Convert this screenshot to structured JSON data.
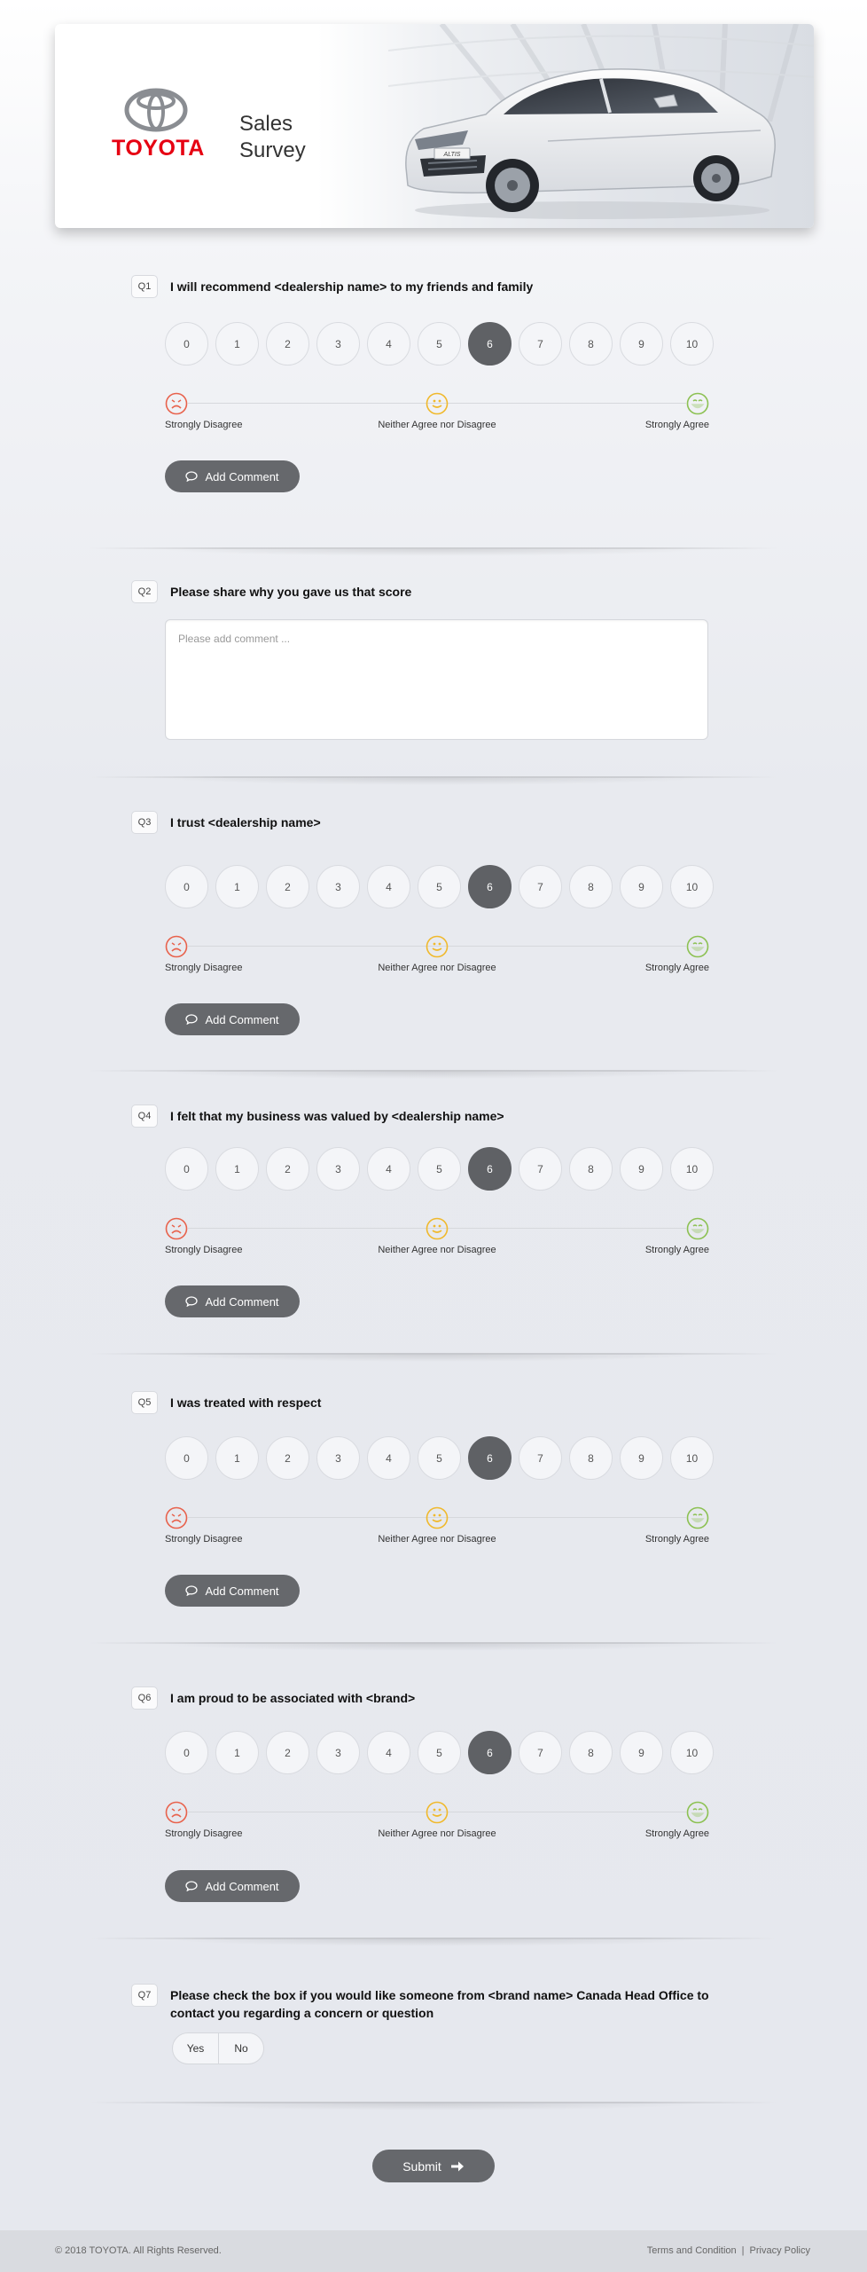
{
  "header": {
    "brand": "TOYOTA",
    "title_line1": "Sales",
    "title_line2": "Survey",
    "car_badge": "ALTIS"
  },
  "scale": {
    "options": [
      "0",
      "1",
      "2",
      "3",
      "4",
      "5",
      "6",
      "7",
      "8",
      "9",
      "10"
    ],
    "left_label": "Strongly Disagree",
    "mid_label": "Neither Agree nor Disagree",
    "right_label": "Strongly Agree"
  },
  "add_comment_label": "Add Comment",
  "questions": {
    "q1": {
      "num": "Q1",
      "text": "I will recommend <dealership name> to my friends and family",
      "selected": 6
    },
    "q2": {
      "num": "Q2",
      "text": "Please share why you gave us that score",
      "placeholder": "Please add comment ..."
    },
    "q3": {
      "num": "Q3",
      "text": "I trust <dealership name>",
      "selected": 6
    },
    "q4": {
      "num": "Q4",
      "text": "I felt that my business was valued by <dealership name>",
      "selected": 6
    },
    "q5": {
      "num": "Q5",
      "text": "I was treated with respect",
      "selected": 6
    },
    "q6": {
      "num": "Q6",
      "text": "I am proud to be associated with <brand>",
      "selected": 6
    },
    "q7": {
      "num": "Q7",
      "text": "Please check the box if you would like someone from <brand name> Canada Head Office to contact you regarding a concern or question",
      "yes": "Yes",
      "no": "No"
    }
  },
  "submit_label": "Submit",
  "footer": {
    "copyright": "© 2018 TOYOTA. All Rights Reserved.",
    "terms": "Terms and Condition",
    "separator": "|",
    "privacy": "Privacy Policy"
  },
  "colors": {
    "selected": "#5f6165",
    "button": "#66686c",
    "brand_red": "#e60012",
    "face_bad": "#e8624c",
    "face_neutral": "#f0b92c",
    "face_good": "#8cc152"
  }
}
